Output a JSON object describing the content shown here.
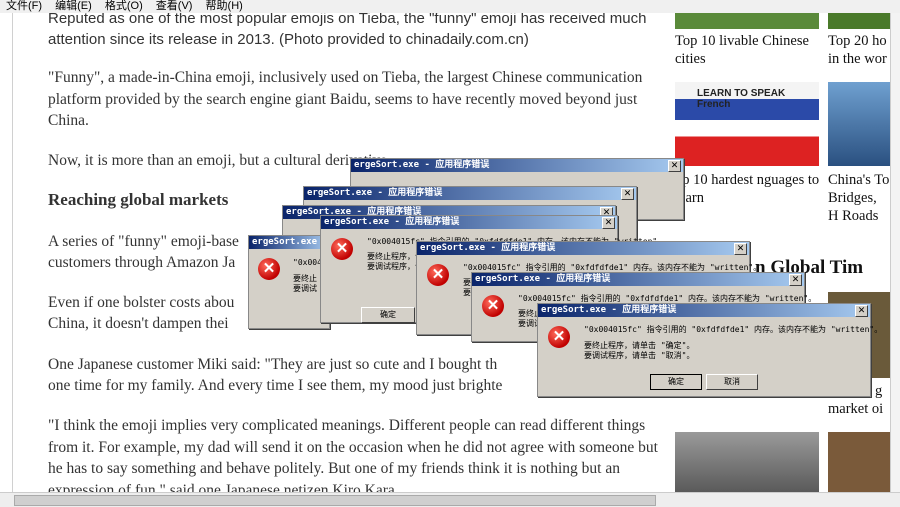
{
  "menu": [
    "文件(F)",
    "编辑(E)",
    "格式(O)",
    "查看(V)",
    "帮助(H)"
  ],
  "article": {
    "caption": "Reputed as one of the most popular emojis on Tieba, the \"funny\" emoji has received much attention since its release in 2013. (Photo provided to chinadaily.com.cn)",
    "p1": "\"Funny\", a made-in-China emoji, inclusively used on Tieba, the largest Chinese communication platform provided by the search engine giant Baidu, seems to have recently moved beyond just China.",
    "p2": "Now, it is more than an emoji, but a cultural derivative",
    "heading": "Reaching global markets",
    "p3": "A series of \"funny\" emoji-base",
    "p3b": "customers through Amazon Ja",
    "p4": "Even if one bolster costs abou",
    "p4b": "China, it doesn't dampen thei",
    "p5": "One Japanese customer Miki said: \"They are just so cute and I bought th",
    "p5b": "one time for my family. And every time I see them, my mood just brighte",
    "p6": "\"I think the emoji implies very complicated meanings. Different people can read different things from it. For example, my dad will send it on the occasion when he did not agree with someone but he has to say something and behave politely. But one of my friends think it is nothing but an expression of fun,\" said one Japanese netizen Kiro Kara."
  },
  "sidebar": {
    "item1": "Top 10 livable Chinese cities",
    "item2": "Top 20 ho in the wor",
    "item3_image_text": "LEARN TO SPEAK French",
    "item3": "op 10 hardest nguages to learn",
    "item4": "China's To Bridges, H Roads",
    "section": "n Global Tim",
    "item5": "g",
    "item6": "market oi"
  },
  "dialog": {
    "title": "ergeSort.exe - 应用程序错误",
    "line1": "\"0x004015fc\" 指令引用的 \"0xfdfdfde1\" 内存。该内存不能为 \"written\"。",
    "line2": "要终止程序，请单击 \"确定\"。",
    "line3": "要调试程序，请单击 \"取消\"。",
    "ok": "确定",
    "cancel": "取消"
  }
}
